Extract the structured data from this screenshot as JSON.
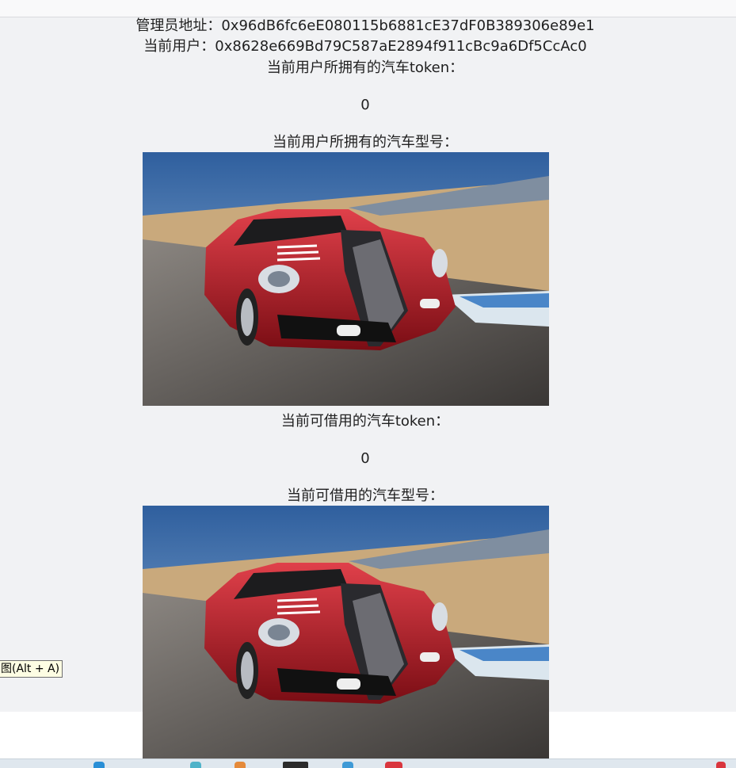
{
  "admin": {
    "label": "管理员地址：",
    "address": "0x96dB6fc6eE080115b6881cE37dF0B389306e89e1"
  },
  "user": {
    "label": "当前用户：",
    "address": "0x8628e669Bd79C587aE2894f911cBc9a6Df5CcAc0"
  },
  "owned": {
    "token_label": "当前用户所拥有的汽车token：",
    "token_count": "0",
    "model_label": "当前用户所拥有的汽车型号："
  },
  "borrowable": {
    "token_label": "当前可借用的汽车token：",
    "token_count": "0",
    "model_label": "当前可借用的汽车型号："
  },
  "tooltip": {
    "text": "图(Alt + A)"
  },
  "colors": {
    "page_bg": "#f1f2f4",
    "car_body": "#c0202a",
    "sky": "#3f6fb0",
    "track": "#c8a77a"
  }
}
